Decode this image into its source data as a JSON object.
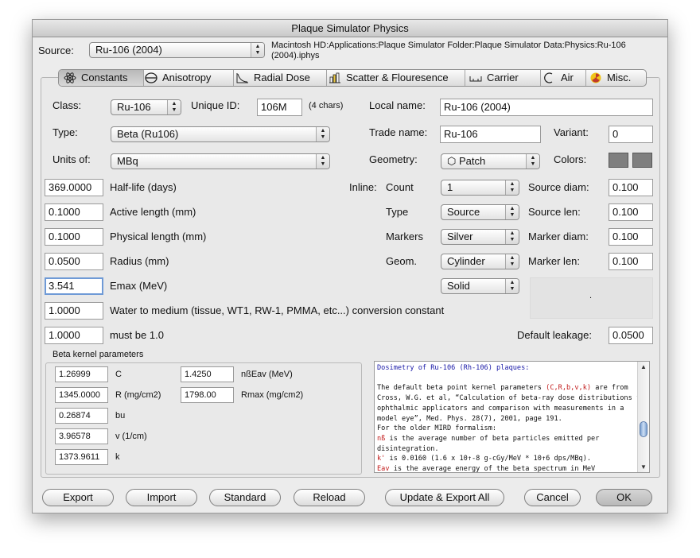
{
  "window": {
    "title": "Plaque Simulator Physics"
  },
  "source": {
    "label": "Source:",
    "selected": "Ru-106 (2004)",
    "path_line1": "Macintosh HD:Applications:Plaque Simulator Folder:Plaque Simulator Data:Physics:Ru-106",
    "path_line2": "(2004).iphys"
  },
  "tabs": [
    {
      "label": "Constants",
      "icon": "atom-icon",
      "selected": true
    },
    {
      "label": "Anisotropy",
      "icon": "anisotropy-icon",
      "selected": false
    },
    {
      "label": "Radial Dose",
      "icon": "radial-dose-icon",
      "selected": false
    },
    {
      "label": "Scatter & Flouresence",
      "icon": "scatter-icon",
      "selected": false
    },
    {
      "label": "Carrier",
      "icon": "carrier-icon",
      "selected": false
    },
    {
      "label": "Air",
      "icon": "air-icon",
      "selected": false
    },
    {
      "label": "Misc.",
      "icon": "radiation-icon",
      "selected": false
    }
  ],
  "constants": {
    "class_label": "Class:",
    "class_value": "Ru-106",
    "unique_id_label": "Unique ID:",
    "unique_id_value": "106M",
    "unique_id_hint": "(4 chars)",
    "local_name_label": "Local name:",
    "local_name_value": "Ru-106 (2004)",
    "type_label": "Type:",
    "type_value": "Beta (Ru106)",
    "trade_name_label": "Trade name:",
    "trade_name_value": "Ru-106",
    "variant_label": "Variant:",
    "variant_value": "0",
    "units_label": "Units of:",
    "units_value": "MBq",
    "geometry_label": "Geometry:",
    "geometry_value": "Patch",
    "colors_label": "Colors:",
    "color_swatches": [
      "#7f7f7f",
      "#7f7f7f"
    ],
    "half_life_value": "369.0000",
    "half_life_label": "Half-life (days)",
    "active_length_value": "0.1000",
    "active_length_label": "Active length (mm)",
    "physical_length_value": "0.1000",
    "physical_length_label": "Physical length (mm)",
    "radius_value": "0.0500",
    "radius_label": "Radius (mm)",
    "emax_value": "3.541",
    "emax_label": "Emax (MeV)",
    "water_value": "1.0000",
    "water_label": "Water to medium (tissue, WT1, RW-1, PMMA, etc...) conversion constant",
    "must_value": "1.0000",
    "must_label": "must be 1.0",
    "inline_label": "Inline:",
    "count_label": "Count",
    "count_value": "1",
    "type2_label": "Type",
    "type2_value": "Source",
    "markers_label": "Markers",
    "markers_value": "Silver",
    "geom_label": "Geom.",
    "geom_value": "Cylinder",
    "solid_value": "Solid",
    "source_diam_label": "Source diam:",
    "source_diam_value": "0.100",
    "source_len_label": "Source len:",
    "source_len_value": "0.100",
    "marker_diam_label": "Marker diam:",
    "marker_diam_value": "0.100",
    "marker_len_label": "Marker len:",
    "marker_len_value": "0.100",
    "default_leakage_label": "Default leakage:",
    "default_leakage_value": "0.0500",
    "preview_dot": "."
  },
  "beta_kernel": {
    "title": "Beta kernel parameters",
    "C_value": "1.26999",
    "C_label": "C",
    "nbEav_value": "1.4250",
    "nbEav_label": "nßEav (MeV)",
    "R_value": "1345.0000",
    "R_label": "R (mg/cm2)",
    "Rmax_value": "1798.00",
    "Rmax_label": "Rmax (mg/cm2)",
    "bu_value": "0.26874",
    "bu_label": "bu",
    "v_value": "3.96578",
    "v_label": "v (1/cm)",
    "k_value": "1373.9611",
    "k_label": "k"
  },
  "notes": {
    "line1": "Dosimetry of Ru-106 (Rh-106) plaques:",
    "line2a": "The default beta point kernel parameters ",
    "line2b": "(C,R,b,v,k)",
    "line2c": " are from",
    "line3": "Cross, W.G. et al, “Calculation of beta-ray dose distributions from",
    "line4": "ophthalmic applicators and comparison with measurements in a",
    "line5": "model eye”, Med. Phys. 28(7), 2001, page 191.",
    "line6": "For the older MIRD formalism:",
    "line7a": "nß",
    "line7b": " is the average number of beta particles emitted per",
    "line8": "disintegration.",
    "line9a": "k'",
    "line9b": " is 0.0160 (1.6 x 10↑-8 g-cGy/MeV * 10↑6 dps/MBq).",
    "line10a": "Eav",
    "line10b": " is the average energy of the beta spectrum in MeV"
  },
  "buttons": {
    "export": "Export",
    "import": "Import",
    "standard": "Standard",
    "reload": "Reload",
    "update_export_all": "Update & Export All",
    "cancel": "Cancel",
    "ok": "OK"
  }
}
